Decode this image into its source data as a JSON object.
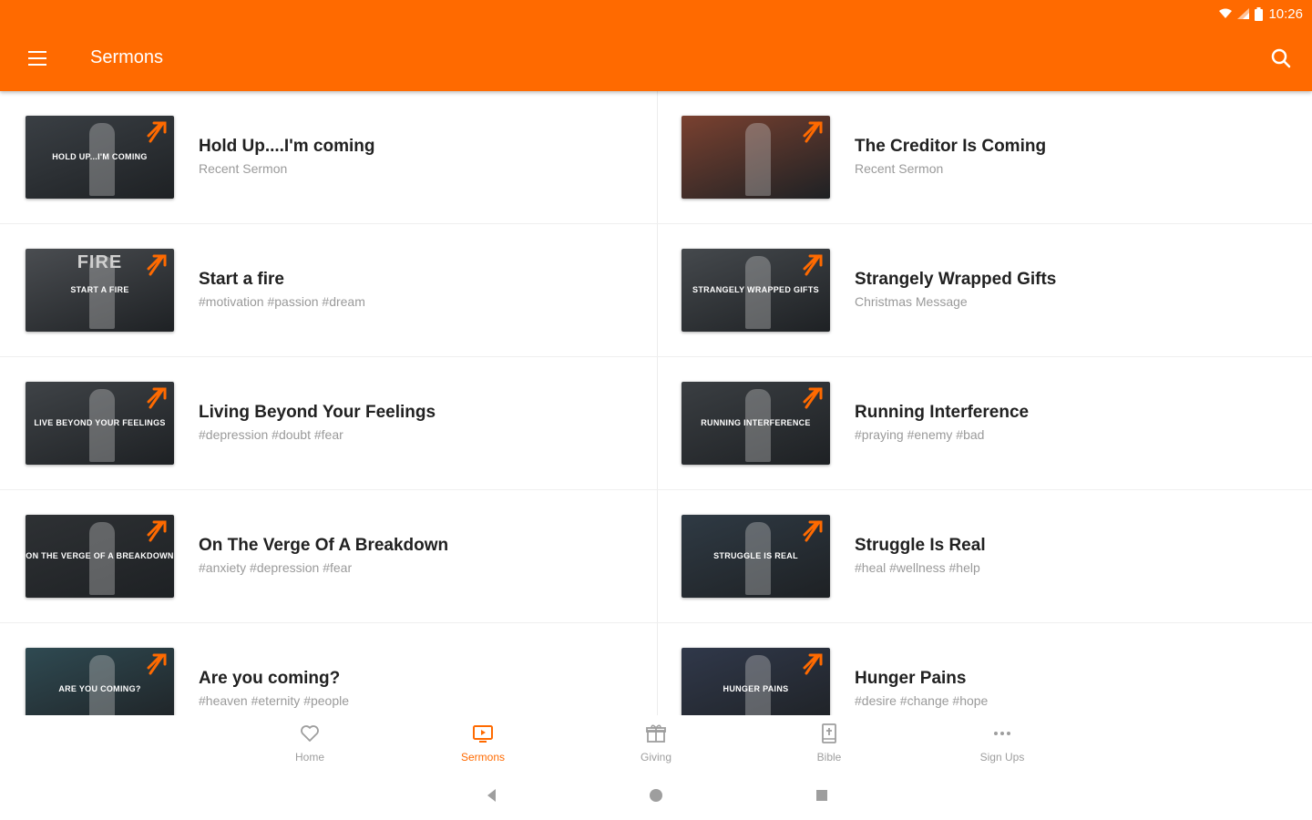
{
  "status_bar": {
    "time": "10:26",
    "icons": [
      "wifi-icon",
      "signal-icon",
      "battery-icon"
    ]
  },
  "app_bar": {
    "title": "Sermons",
    "menu_icon": "menu-icon",
    "search_icon": "search-icon",
    "color": "#ff6a00"
  },
  "sermons": [
    {
      "title": "Hold Up....I'm coming",
      "subtitle": "Recent Sermon",
      "thumb_text": "HOLD UP...I'M COMING",
      "thumb_bg": "#3a3f44"
    },
    {
      "title": "The Creditor Is Coming",
      "subtitle": "Recent Sermon",
      "thumb_text": "",
      "thumb_bg": "#7a4130"
    },
    {
      "title": "Start a fire",
      "subtitle": "#motivation #passion #dream",
      "thumb_text": "START A FIRE",
      "thumb_big": "FIRE",
      "thumb_bg": "#4a4d51"
    },
    {
      "title": "Strangely Wrapped Gifts",
      "subtitle": "Christmas Message",
      "thumb_text": "STRANGELY WRAPPED GIFTS",
      "thumb_bg": "#45494d"
    },
    {
      "title": "Living Beyond Your Feelings",
      "subtitle": "#depression #doubt #fear",
      "thumb_text": "LIVE BEYOND YOUR FEELINGS",
      "thumb_bg": "#3f4347"
    },
    {
      "title": "Running Interference",
      "subtitle": "#praying #enemy #bad",
      "thumb_text": "RUNNING INTERFERENCE",
      "thumb_bg": "#3a3e42"
    },
    {
      "title": "On The Verge Of A Breakdown",
      "subtitle": "#anxiety #depression #fear",
      "thumb_text": "ON THE VERGE OF A BREAKDOWN",
      "thumb_bg": "#2e3134"
    },
    {
      "title": "Struggle Is Real",
      "subtitle": "#heal #wellness #help",
      "thumb_text": "STRUGGLE IS REAL",
      "thumb_bg": "#2f3a44"
    },
    {
      "title": "Are you coming?",
      "subtitle": "#heaven #eternity #people",
      "thumb_text": "ARE YOU COMING?",
      "thumb_bg": "#2f4a52"
    },
    {
      "title": "Hunger Pains",
      "subtitle": "#desire #change #hope",
      "thumb_text": "HUNGER PAINS",
      "thumb_bg": "#30384a"
    }
  ],
  "bottom_nav": [
    {
      "label": "Home",
      "icon": "heart-icon",
      "active": false
    },
    {
      "label": "Sermons",
      "icon": "tv-play-icon",
      "active": true
    },
    {
      "label": "Giving",
      "icon": "gift-icon",
      "active": false
    },
    {
      "label": "Bible",
      "icon": "bible-icon",
      "active": false
    },
    {
      "label": "Sign Ups",
      "icon": "more-icon",
      "active": false
    }
  ],
  "colors": {
    "accent": "#ff6a00",
    "inactive": "#9e9e9e"
  }
}
